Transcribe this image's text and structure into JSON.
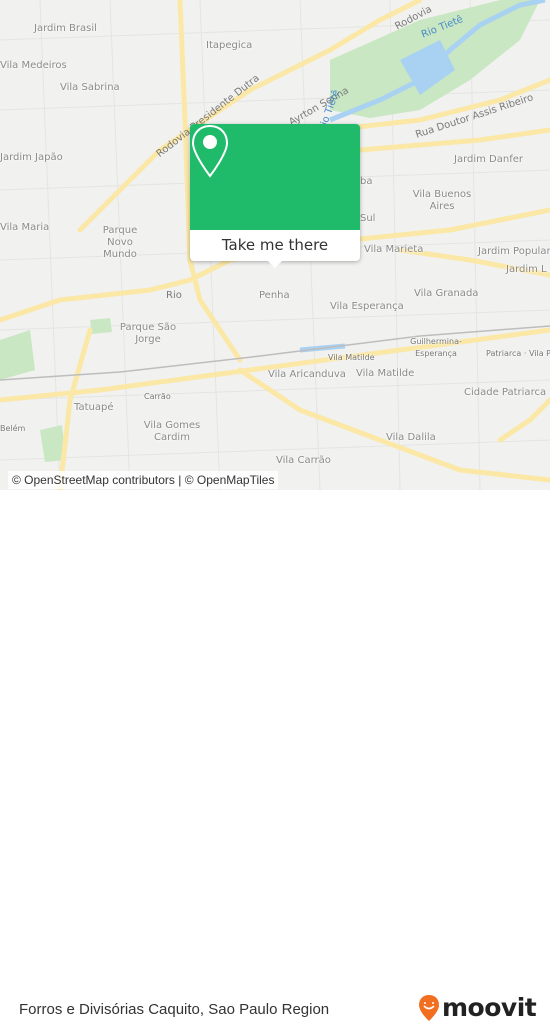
{
  "map": {
    "area_labels": [
      "Jardim Brasil",
      "Itapegica",
      "Vila Medeiros",
      "Vila Sabrina",
      "Jardim Japão",
      "Jardim Danfer",
      "Vila Buenos Aires",
      "Vila Maria",
      "Parque Novo Mundo",
      "Vila Marieta",
      "Jardim Popular",
      "Jardim L",
      "Penha",
      "Vila Esperança",
      "Vila Granada",
      "Parque São Jorge",
      "Vila Matilde",
      "Guilhermina-Esperança",
      "Patriarca · Vila Pa",
      "Vila Aricanduva",
      "Vila Matilde",
      "Cidade Patriarca",
      "Tatuapé",
      "Carrão",
      "Vila Gomes Cardim",
      "Vila Dalila",
      "Vila Carrão",
      "Belém",
      "ba",
      "Sul"
    ],
    "road_labels": [
      "Rodovia Presidente Dutra",
      "Rua Doutor Assis Ribeiro",
      "Rodovia",
      "Ayrton Senna",
      "Rio Tietê",
      "Rio Tietê",
      "Rio"
    ],
    "colors": {
      "background": "#f1f1ef",
      "road": "#fbe8a6",
      "park": "#c9e7c3",
      "water": "#a9d2f2"
    }
  },
  "popup": {
    "button_label": "Take me there",
    "color": "#1fba6a",
    "icon": "map-pin-icon"
  },
  "attribution": "© OpenStreetMap contributors | © OpenMapTiles",
  "footer": {
    "place_name": "Forros e Divisórias Caquito, Sao Paulo Region",
    "logo": "moovit",
    "logo_color": "#f26f21"
  }
}
